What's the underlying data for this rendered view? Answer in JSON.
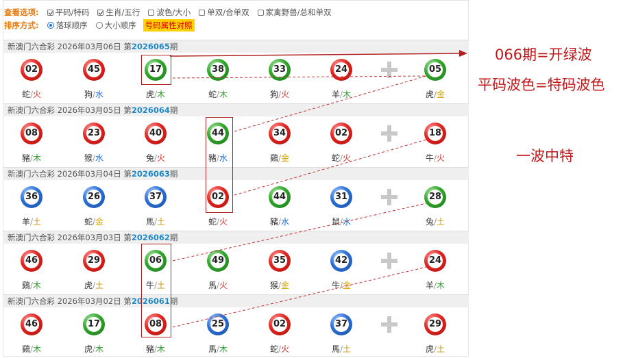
{
  "options": {
    "view_title": "查看选项:",
    "view_items": [
      {
        "label": "平码/特码",
        "checked": true
      },
      {
        "label": "生肖/五行",
        "checked": true
      },
      {
        "label": "波色/大小",
        "checked": false
      },
      {
        "label": "单双/合单双",
        "checked": false
      },
      {
        "label": "家禽野兽/总和单双",
        "checked": false
      }
    ],
    "sort_title": "排序方式:",
    "sort_items": [
      {
        "label": "落球顺序",
        "selected": true
      },
      {
        "label": "大小顺序",
        "selected": false
      }
    ],
    "attr_button": "号码属性对照"
  },
  "draws": [
    {
      "prefix": "新澳门六合彩 2026年03月06日 第",
      "issue": "2026065",
      "suffix": "期",
      "balls": [
        {
          "n": "02",
          "c": "red",
          "z": "蛇",
          "e": "火"
        },
        {
          "n": "45",
          "c": "red",
          "z": "狗",
          "e": "水"
        },
        {
          "n": "17",
          "c": "green",
          "z": "虎",
          "e": "木"
        },
        {
          "n": "38",
          "c": "green",
          "z": "蛇",
          "e": "木"
        },
        {
          "n": "33",
          "c": "green",
          "z": "狗",
          "e": "火"
        },
        {
          "n": "24",
          "c": "red",
          "z": "羊",
          "e": "木"
        },
        {
          "n": "05",
          "c": "green",
          "z": "虎",
          "e": "金"
        }
      ]
    },
    {
      "prefix": "新澳门六合彩 2026年03月05日 第",
      "issue": "2026064",
      "suffix": "期",
      "balls": [
        {
          "n": "08",
          "c": "red",
          "z": "豬",
          "e": "木"
        },
        {
          "n": "23",
          "c": "red",
          "z": "猴",
          "e": "水"
        },
        {
          "n": "40",
          "c": "red",
          "z": "兔",
          "e": "火"
        },
        {
          "n": "44",
          "c": "green",
          "z": "豬",
          "e": "水"
        },
        {
          "n": "34",
          "c": "red",
          "z": "鷄",
          "e": "金"
        },
        {
          "n": "02",
          "c": "red",
          "z": "蛇",
          "e": "火"
        },
        {
          "n": "18",
          "c": "red",
          "z": "牛",
          "e": "火"
        }
      ]
    },
    {
      "prefix": "新澳门六合彩 2026年03月04日 第",
      "issue": "2026063",
      "suffix": "期",
      "balls": [
        {
          "n": "36",
          "c": "blue",
          "z": "羊",
          "e": "土"
        },
        {
          "n": "26",
          "c": "blue",
          "z": "蛇",
          "e": "金"
        },
        {
          "n": "37",
          "c": "blue",
          "z": "馬",
          "e": "土"
        },
        {
          "n": "02",
          "c": "red",
          "z": "蛇",
          "e": "火"
        },
        {
          "n": "44",
          "c": "green",
          "z": "豬",
          "e": "水"
        },
        {
          "n": "31",
          "c": "blue",
          "z": "鼠",
          "e": "水"
        },
        {
          "n": "28",
          "c": "green",
          "z": "兔",
          "e": "土"
        }
      ]
    },
    {
      "prefix": "新澳门六合彩 2026年03月03日 第",
      "issue": "2026062",
      "suffix": "期",
      "balls": [
        {
          "n": "46",
          "c": "red",
          "z": "鷄",
          "e": "木"
        },
        {
          "n": "29",
          "c": "red",
          "z": "虎",
          "e": "土"
        },
        {
          "n": "06",
          "c": "green",
          "z": "牛",
          "e": "土"
        },
        {
          "n": "49",
          "c": "green",
          "z": "馬",
          "e": "火"
        },
        {
          "n": "35",
          "c": "red",
          "z": "猴",
          "e": "金"
        },
        {
          "n": "42",
          "c": "blue",
          "z": "牛",
          "e": "金"
        },
        {
          "n": "24",
          "c": "red",
          "z": "羊",
          "e": "木"
        }
      ]
    },
    {
      "prefix": "新澳门六合彩 2026年03月02日 第",
      "issue": "2026061",
      "suffix": "期",
      "balls": [
        {
          "n": "46",
          "c": "red",
          "z": "鷄",
          "e": "木"
        },
        {
          "n": "17",
          "c": "green",
          "z": "虎",
          "e": "木"
        },
        {
          "n": "08",
          "c": "red",
          "z": "豬",
          "e": "木"
        },
        {
          "n": "25",
          "c": "blue",
          "z": "馬",
          "e": "木"
        },
        {
          "n": "02",
          "c": "red",
          "z": "蛇",
          "e": "火"
        },
        {
          "n": "37",
          "c": "blue",
          "z": "馬",
          "e": "土"
        },
        {
          "n": "29",
          "c": "red",
          "z": "虎",
          "e": "土"
        }
      ]
    }
  ],
  "notes": {
    "line1": "066期=开绿波",
    "line2": "平码波色=特码波色",
    "line3": "一波中特"
  },
  "colors": {
    "annotation": "#c0181a",
    "issue": "#1e88c8",
    "red_ball": "#e0241f",
    "green_ball": "#2fa52a",
    "blue_ball": "#2b6fd6"
  }
}
